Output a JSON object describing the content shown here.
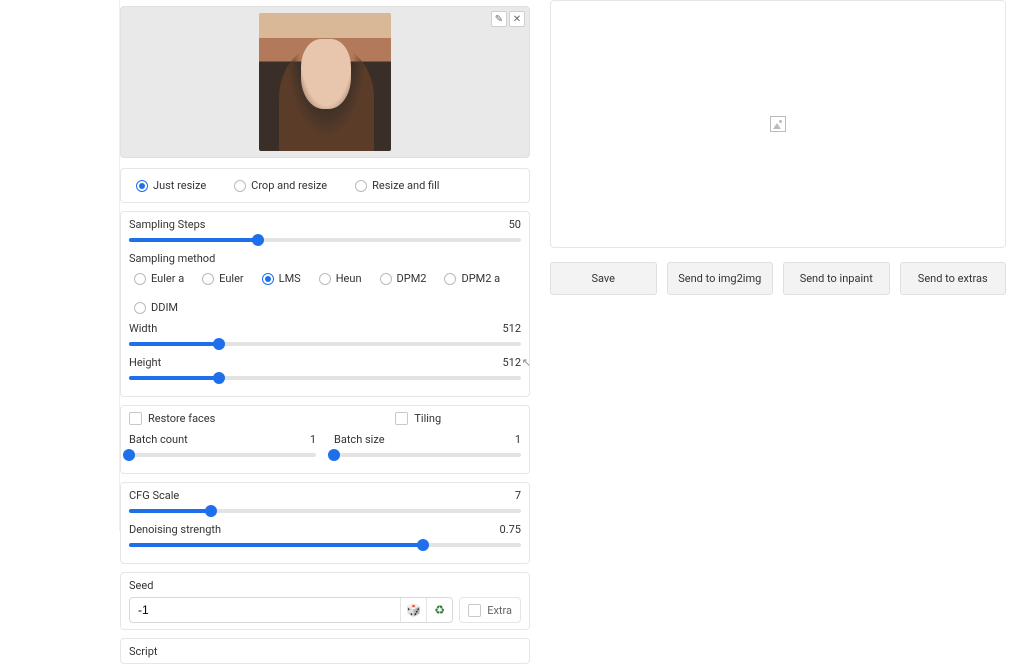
{
  "image_panel": {
    "edit_tool": "✎",
    "close_tool": "✕"
  },
  "resize_mode": {
    "options": [
      {
        "label": "Just resize",
        "selected": true
      },
      {
        "label": "Crop and resize",
        "selected": false
      },
      {
        "label": "Resize and fill",
        "selected": false
      }
    ]
  },
  "sampling_steps": {
    "label": "Sampling Steps",
    "value": 50,
    "min": 1,
    "max": 150,
    "percent": 33
  },
  "sampling_method": {
    "label": "Sampling method",
    "options": [
      {
        "label": "Euler a",
        "selected": false
      },
      {
        "label": "Euler",
        "selected": false
      },
      {
        "label": "LMS",
        "selected": true
      },
      {
        "label": "Heun",
        "selected": false
      },
      {
        "label": "DPM2",
        "selected": false
      },
      {
        "label": "DPM2 a",
        "selected": false
      },
      {
        "label": "DDIM",
        "selected": false
      }
    ]
  },
  "width": {
    "label": "Width",
    "value": 512,
    "min": 64,
    "max": 2048,
    "percent": 23
  },
  "height": {
    "label": "Height",
    "value": 512,
    "min": 64,
    "max": 2048,
    "percent": 23
  },
  "restore_faces": {
    "label": "Restore faces",
    "checked": false
  },
  "tiling": {
    "label": "Tiling",
    "checked": false
  },
  "batch_count": {
    "label": "Batch count",
    "value": 1,
    "min": 1,
    "max": 100,
    "percent": 0
  },
  "batch_size": {
    "label": "Batch size",
    "value": 1,
    "min": 1,
    "max": 100,
    "percent": 0
  },
  "cfg_scale": {
    "label": "CFG Scale",
    "value": 7,
    "min": 1,
    "max": 30,
    "percent": 21
  },
  "denoising": {
    "label": "Denoising strength",
    "value": 0.75,
    "min": 0,
    "max": 1,
    "percent": 75
  },
  "seed": {
    "label": "Seed",
    "value": "-1",
    "dice_icon": "🎲",
    "recycle_icon": "♻",
    "extra_label": "Extra",
    "extra_checked": false
  },
  "script": {
    "label": "Script"
  },
  "action_buttons": {
    "save": "Save",
    "send_img2img": "Send to img2img",
    "send_inpaint": "Send to inpaint",
    "send_extras": "Send to extras"
  }
}
